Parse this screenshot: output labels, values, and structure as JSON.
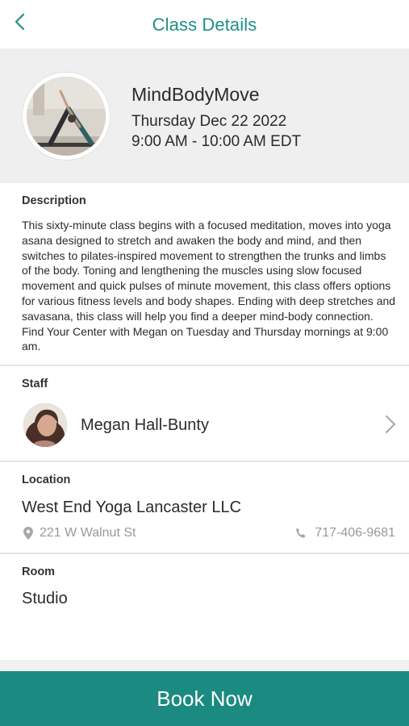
{
  "header": {
    "title": "Class Details",
    "back_icon": "chevron-left-icon"
  },
  "colors": {
    "accent": "#1f8f86",
    "book_button": "#1b8a80",
    "summary_bg": "#efefef",
    "muted_text": "#999999"
  },
  "class": {
    "name": "MindBodyMove",
    "date": "Thursday Dec 22 2022",
    "time": "9:00 AM - 10:00 AM EDT"
  },
  "description": {
    "label": "Description",
    "text": "This sixty-minute class begins with a focused meditation, moves into yoga asana designed to stretch and awaken the body and mind, and then switches to pilates-inspired movement to strengthen the trunks and limbs of the body. Toning and lengthening the muscles using slow focused movement and quick pulses of minute movement, this class offers options for various fitness levels and body shapes. Ending with deep stretches and savasana, this class will help you find a deeper mind-body connection. Find Your Center with Megan on Tuesday and Thursday mornings at 9:00 am."
  },
  "staff": {
    "label": "Staff",
    "name": "Megan Hall-Bunty",
    "chevron_icon": "chevron-right-icon"
  },
  "location": {
    "label": "Location",
    "name": "West End Yoga Lancaster LLC",
    "address": "221 W Walnut St",
    "address_icon": "map-pin-icon",
    "phone": "717-406-9681",
    "phone_icon": "phone-icon"
  },
  "room": {
    "label": "Room",
    "name": "Studio"
  },
  "footer": {
    "book_label": "Book Now"
  }
}
